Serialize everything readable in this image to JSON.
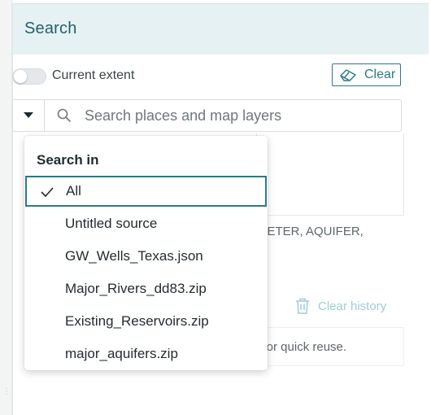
{
  "panel": {
    "title": "Search"
  },
  "extent_toggle": {
    "label": "Current extent",
    "on": false
  },
  "clear_button": {
    "label": "Clear",
    "icon": "eraser-icon"
  },
  "search": {
    "placeholder": "Search places and map layers",
    "value": ""
  },
  "background": {
    "fields_text": "METER, AQUIFER,",
    "clear_history_label": "Clear history",
    "hint_text": "e for quick reuse."
  },
  "search_in_menu": {
    "heading": "Search in",
    "selected_index": 0,
    "items": [
      {
        "label": "All"
      },
      {
        "label": "Untitled source"
      },
      {
        "label": "GW_Wells_Texas.json"
      },
      {
        "label": "Major_Rivers_dd83.zip"
      },
      {
        "label": "Existing_Reservoirs.zip"
      },
      {
        "label": "major_aquifers.zip"
      }
    ]
  },
  "colors": {
    "accent": "#2c7a83",
    "header_bg": "#e6f1f3",
    "title": "#23606a",
    "muted_accent": "#9ccfd3"
  }
}
